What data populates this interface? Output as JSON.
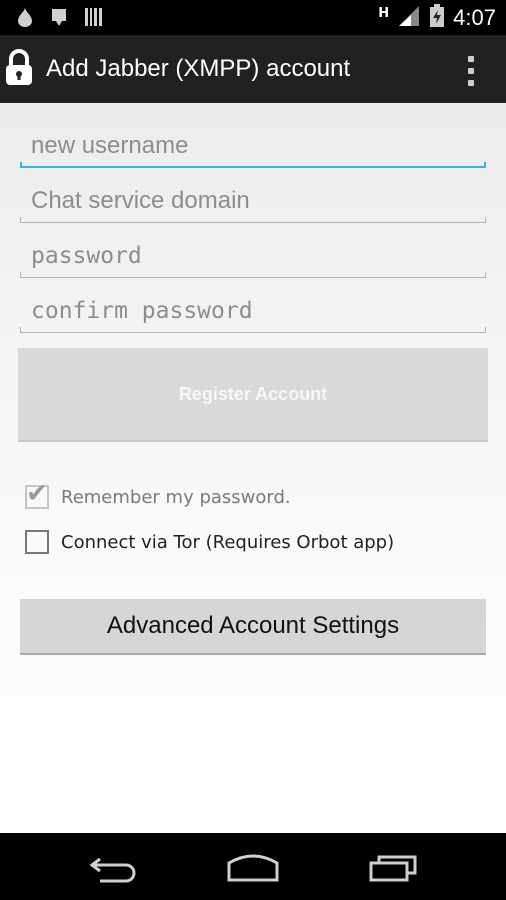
{
  "status_bar": {
    "time": "4:07",
    "network_letter": "H"
  },
  "action_bar": {
    "title": "Add Jabber (XMPP) account"
  },
  "form": {
    "username_placeholder": "new username",
    "domain_placeholder": "Chat service domain",
    "password_placeholder": "password",
    "confirm_placeholder": "confirm password",
    "register_label": "Register Account",
    "remember_label": "Remember my password.",
    "tor_label": "Connect via Tor (Requires Orbot app)",
    "advanced_label": "Advanced Account Settings"
  },
  "colors": {
    "focus_accent": "#33b5e5",
    "action_bar": "#212121"
  }
}
